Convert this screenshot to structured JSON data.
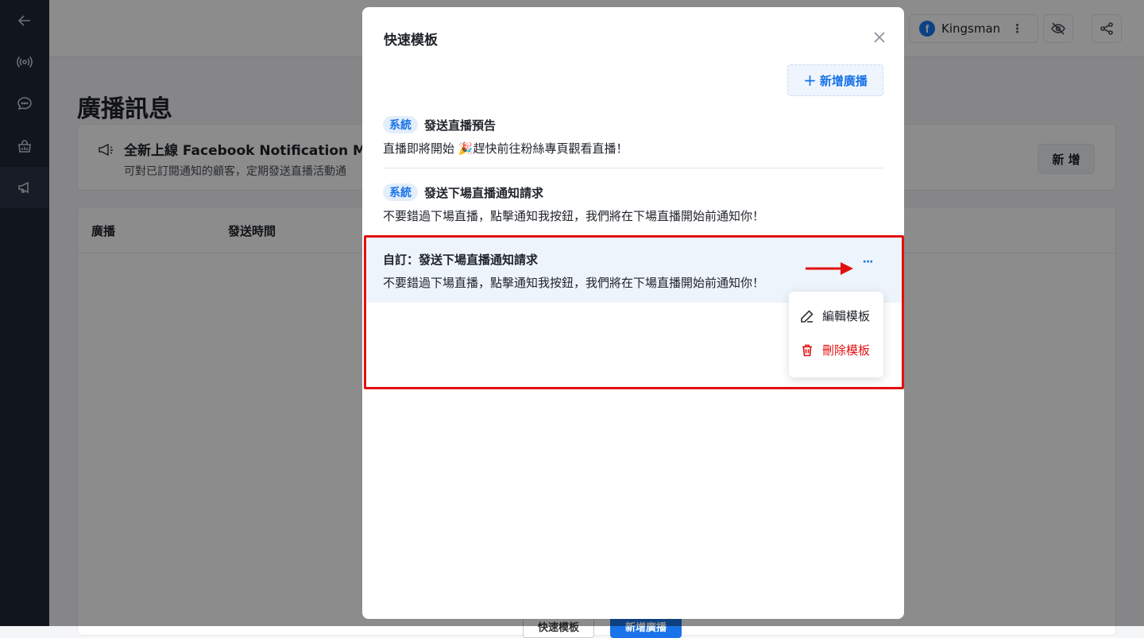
{
  "page": {
    "title": "廣播訊息",
    "notice_title": "全新上線 Facebook Notification Mess",
    "notice_desc": "可對已訂閱通知的顧客，定期發送直播活動通",
    "add_label": "新 增"
  },
  "header": {
    "page_name": "Kingsman",
    "kebab": "⋮"
  },
  "table": {
    "columns": [
      "廣播",
      "發送時間"
    ],
    "footer_buttons": [
      "快速模板",
      "新增廣播"
    ]
  },
  "modal": {
    "title": "快速模板",
    "new_button_label": "新增廣播",
    "plus": "+",
    "templates": [
      {
        "badge": "系統",
        "title": "發送直播預告",
        "body": "直播即將開始 🎉趕快前往粉絲專頁觀看直播！"
      },
      {
        "badge": "系統",
        "title": "發送下場直播通知請求",
        "body": "不要錯過下場直播，點擊通知我按鈕，我們將在下場直播開始前通知你！"
      },
      {
        "badge": "",
        "title": "自訂：發送下場直播通知請求",
        "body": "不要錯過下場直播，點擊通知我按鈕，我們將在下場直播開始前通知你！"
      }
    ],
    "more_label": "···",
    "menu": {
      "edit_label": "編輯模板",
      "delete_label": "刪除模板"
    }
  },
  "colors": {
    "sidebar": "#1f2736",
    "accent": "#1a73e8",
    "danger": "#e21010",
    "highlight_row": "#eef4fc"
  },
  "icons": [
    "back-arrow-icon",
    "broadcast-icon",
    "chat-icon",
    "shop-icon",
    "megaphone-icon",
    "facebook-icon",
    "hide-eye-icon",
    "share-icon",
    "close-icon",
    "more-icon",
    "edit-icon",
    "trash-icon"
  ]
}
